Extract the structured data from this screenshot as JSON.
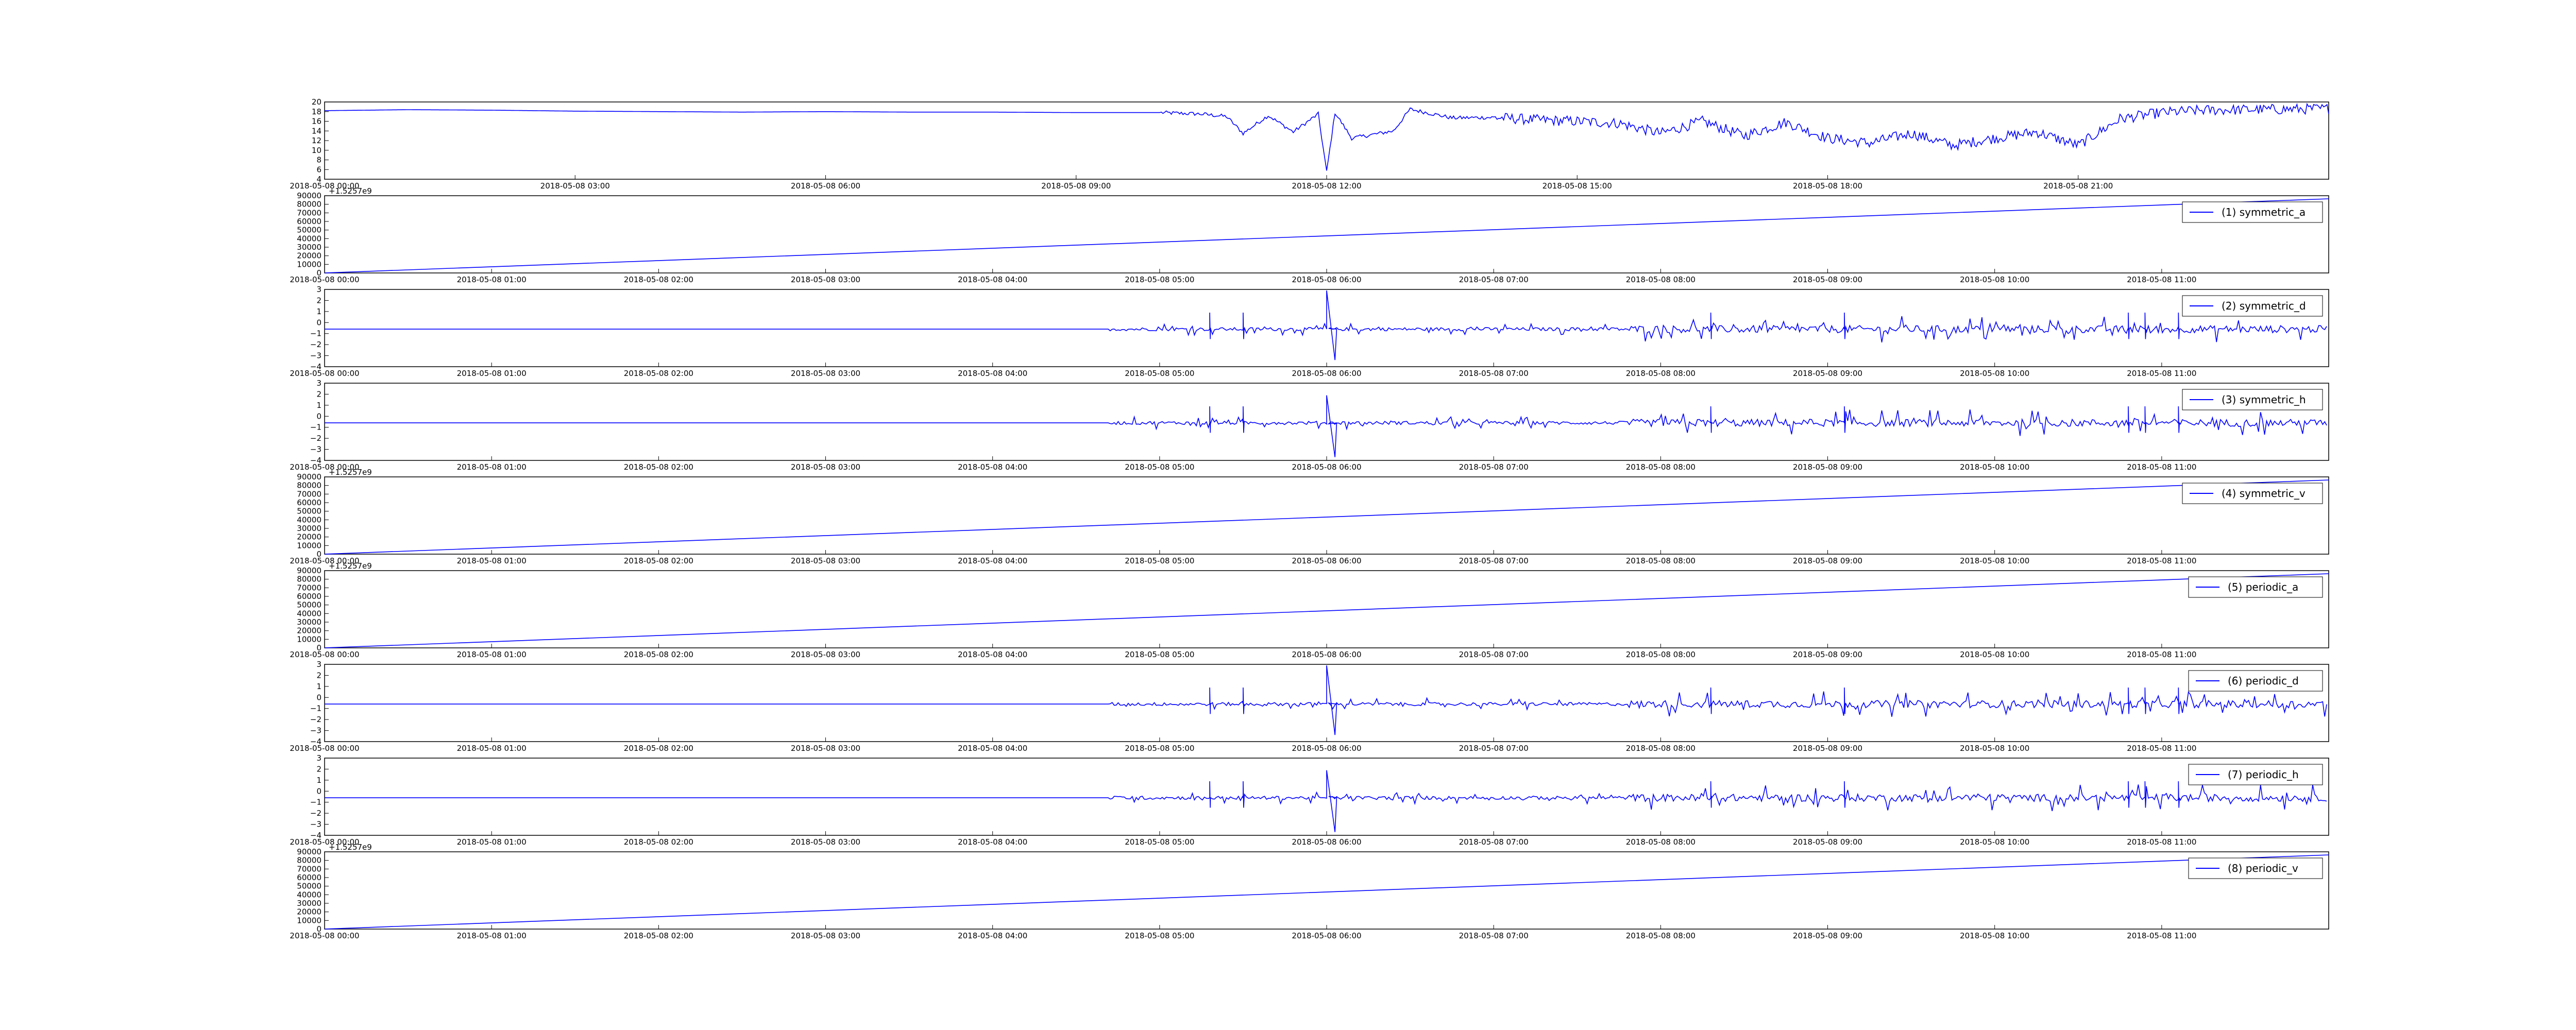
{
  "colors": {
    "series": "#0000ff",
    "axes": "#000000",
    "background": "#ffffff"
  },
  "chart_data": [
    {
      "type": "line",
      "title": "",
      "xlabel": "",
      "ylabel": "",
      "x_ticks": [
        "2018-05-08 00:00",
        "2018-05-08 03:00",
        "2018-05-08 06:00",
        "2018-05-08 09:00",
        "2018-05-08 12:00",
        "2018-05-08 15:00",
        "2018-05-08 18:00",
        "2018-05-08 21:00"
      ],
      "x_range_hours": [
        0,
        24
      ],
      "ylim": [
        4,
        20
      ],
      "y_ticks": [
        "4",
        "6",
        "8",
        "10",
        "12",
        "14",
        "16",
        "18",
        "20"
      ],
      "offset_text": "",
      "legend": "",
      "series": [
        {
          "values_hours": [
            0,
            1,
            2,
            3,
            4,
            5,
            6,
            7,
            8,
            9,
            10,
            10.5,
            10.8,
            11,
            11.3,
            11.6,
            11.9,
            12,
            12.1,
            12.3,
            12.8,
            13,
            13.5,
            14,
            14.5,
            15,
            15.5,
            16,
            16.5,
            17,
            17.5,
            18,
            18.5,
            19,
            19.5,
            20,
            20.5,
            21,
            21.5,
            22,
            22.5,
            23,
            24
          ],
          "values": [
            18.2,
            18.4,
            18.3,
            18.1,
            18.0,
            17.9,
            18.0,
            17.9,
            17.9,
            17.8,
            17.8,
            17.5,
            17.0,
            13.5,
            17.2,
            13.8,
            17.5,
            5.5,
            17.8,
            12.5,
            14.0,
            18.5,
            16.7,
            16.8,
            16.3,
            16.0,
            15.6,
            13.5,
            16.0,
            13.0,
            15.8,
            12.5,
            11.5,
            13.5,
            11.0,
            12.5,
            13.8,
            11.0,
            16.5,
            17.8,
            18.3,
            18.4,
            18.6
          ]
        }
      ]
    },
    {
      "type": "line",
      "title": "",
      "xlabel": "",
      "ylabel": "",
      "x_ticks": [
        "2018-05-08 00:00",
        "2018-05-08 01:00",
        "2018-05-08 02:00",
        "2018-05-08 03:00",
        "2018-05-08 04:00",
        "2018-05-08 05:00",
        "2018-05-08 06:00",
        "2018-05-08 07:00",
        "2018-05-08 08:00",
        "2018-05-08 09:00",
        "2018-05-08 10:00",
        "2018-05-08 11:00"
      ],
      "x_range_hours": [
        0,
        12
      ],
      "ylim": [
        0,
        90000
      ],
      "y_ticks": [
        "0",
        "10000",
        "20000",
        "30000",
        "40000",
        "50000",
        "60000",
        "70000",
        "80000",
        "90000"
      ],
      "offset_text": "+1.5257e9",
      "legend": "right",
      "series": [
        {
          "name": "(1) symmetric_a",
          "x": [
            0,
            12
          ],
          "values": [
            0,
            86400
          ]
        }
      ]
    },
    {
      "type": "line",
      "title": "",
      "xlabel": "",
      "ylabel": "",
      "x_ticks": [
        "2018-05-08 00:00",
        "2018-05-08 01:00",
        "2018-05-08 02:00",
        "2018-05-08 03:00",
        "2018-05-08 04:00",
        "2018-05-08 05:00",
        "2018-05-08 06:00",
        "2018-05-08 07:00",
        "2018-05-08 08:00",
        "2018-05-08 09:00",
        "2018-05-08 10:00",
        "2018-05-08 11:00"
      ],
      "x_range_hours": [
        0,
        12
      ],
      "ylim": [
        -4,
        3
      ],
      "y_ticks": [
        "−4",
        "−3",
        "−2",
        "−1",
        "0",
        "1",
        "2",
        "3"
      ],
      "offset_text": "",
      "legend": "right",
      "series": [
        {
          "name": "(2) symmetric_d",
          "baseline": -0.6,
          "noise_start_hours": 4.7,
          "spike": {
            "x": 6.0,
            "up": 2.9,
            "down": -3.4
          }
        }
      ]
    },
    {
      "type": "line",
      "title": "",
      "xlabel": "",
      "ylabel": "",
      "x_ticks": [
        "2018-05-08 00:00",
        "2018-05-08 01:00",
        "2018-05-08 02:00",
        "2018-05-08 03:00",
        "2018-05-08 04:00",
        "2018-05-08 05:00",
        "2018-05-08 06:00",
        "2018-05-08 07:00",
        "2018-05-08 08:00",
        "2018-05-08 09:00",
        "2018-05-08 10:00",
        "2018-05-08 11:00"
      ],
      "x_range_hours": [
        0,
        12
      ],
      "ylim": [
        -4,
        3
      ],
      "y_ticks": [
        "−4",
        "−3",
        "−2",
        "−1",
        "0",
        "1",
        "2",
        "3"
      ],
      "offset_text": "",
      "legend": "right",
      "series": [
        {
          "name": "(3) symmetric_h",
          "baseline": -0.6,
          "noise_start_hours": 4.7,
          "spike": {
            "x": 6.0,
            "up": 1.9,
            "down": -3.7
          }
        }
      ]
    },
    {
      "type": "line",
      "title": "",
      "xlabel": "",
      "ylabel": "",
      "x_ticks": [
        "2018-05-08 00:00",
        "2018-05-08 01:00",
        "2018-05-08 02:00",
        "2018-05-08 03:00",
        "2018-05-08 04:00",
        "2018-05-08 05:00",
        "2018-05-08 06:00",
        "2018-05-08 07:00",
        "2018-05-08 08:00",
        "2018-05-08 09:00",
        "2018-05-08 10:00",
        "2018-05-08 11:00"
      ],
      "x_range_hours": [
        0,
        12
      ],
      "ylim": [
        0,
        90000
      ],
      "y_ticks": [
        "0",
        "10000",
        "20000",
        "30000",
        "40000",
        "50000",
        "60000",
        "70000",
        "80000",
        "90000"
      ],
      "offset_text": "+1.5257e9",
      "legend": "right",
      "series": [
        {
          "name": "(4) symmetric_v",
          "x": [
            0,
            12
          ],
          "values": [
            0,
            86400
          ]
        }
      ]
    },
    {
      "type": "line",
      "title": "",
      "xlabel": "",
      "ylabel": "",
      "x_ticks": [
        "2018-05-08 00:00",
        "2018-05-08 01:00",
        "2018-05-08 02:00",
        "2018-05-08 03:00",
        "2018-05-08 04:00",
        "2018-05-08 05:00",
        "2018-05-08 06:00",
        "2018-05-08 07:00",
        "2018-05-08 08:00",
        "2018-05-08 09:00",
        "2018-05-08 10:00",
        "2018-05-08 11:00"
      ],
      "x_range_hours": [
        0,
        12
      ],
      "ylim": [
        0,
        90000
      ],
      "y_ticks": [
        "0",
        "10000",
        "20000",
        "30000",
        "40000",
        "50000",
        "60000",
        "70000",
        "80000",
        "90000"
      ],
      "offset_text": "+1.5257e9",
      "legend": "right",
      "series": [
        {
          "name": "(5) periodic_a",
          "x": [
            0,
            12
          ],
          "values": [
            0,
            86400
          ]
        }
      ]
    },
    {
      "type": "line",
      "title": "",
      "xlabel": "",
      "ylabel": "",
      "x_ticks": [
        "2018-05-08 00:00",
        "2018-05-08 01:00",
        "2018-05-08 02:00",
        "2018-05-08 03:00",
        "2018-05-08 04:00",
        "2018-05-08 05:00",
        "2018-05-08 06:00",
        "2018-05-08 07:00",
        "2018-05-08 08:00",
        "2018-05-08 09:00",
        "2018-05-08 10:00",
        "2018-05-08 11:00"
      ],
      "x_range_hours": [
        0,
        12
      ],
      "ylim": [
        -4,
        3
      ],
      "y_ticks": [
        "−4",
        "−3",
        "−2",
        "−1",
        "0",
        "1",
        "2",
        "3"
      ],
      "offset_text": "",
      "legend": "right",
      "series": [
        {
          "name": "(6) periodic_d",
          "baseline": -0.6,
          "noise_start_hours": 4.7,
          "spike": {
            "x": 6.0,
            "up": 2.9,
            "down": -3.4
          }
        }
      ]
    },
    {
      "type": "line",
      "title": "",
      "xlabel": "",
      "ylabel": "",
      "x_ticks": [
        "2018-05-08 00:00",
        "2018-05-08 01:00",
        "2018-05-08 02:00",
        "2018-05-08 03:00",
        "2018-05-08 04:00",
        "2018-05-08 05:00",
        "2018-05-08 06:00",
        "2018-05-08 07:00",
        "2018-05-08 08:00",
        "2018-05-08 09:00",
        "2018-05-08 10:00",
        "2018-05-08 11:00"
      ],
      "x_range_hours": [
        0,
        12
      ],
      "ylim": [
        -4,
        3
      ],
      "y_ticks": [
        "−4",
        "−3",
        "−2",
        "−1",
        "0",
        "1",
        "2",
        "3"
      ],
      "offset_text": "",
      "legend": "right",
      "series": [
        {
          "name": "(7) periodic_h",
          "baseline": -0.6,
          "noise_start_hours": 4.7,
          "spike": {
            "x": 6.0,
            "up": 1.9,
            "down": -3.7
          }
        }
      ]
    },
    {
      "type": "line",
      "title": "",
      "xlabel": "",
      "ylabel": "",
      "x_ticks": [
        "2018-05-08 00:00",
        "2018-05-08 01:00",
        "2018-05-08 02:00",
        "2018-05-08 03:00",
        "2018-05-08 04:00",
        "2018-05-08 05:00",
        "2018-05-08 06:00",
        "2018-05-08 07:00",
        "2018-05-08 08:00",
        "2018-05-08 09:00",
        "2018-05-08 10:00",
        "2018-05-08 11:00"
      ],
      "x_range_hours": [
        0,
        12
      ],
      "ylim": [
        0,
        90000
      ],
      "y_ticks": [
        "0",
        "10000",
        "20000",
        "30000",
        "40000",
        "50000",
        "60000",
        "70000",
        "80000",
        "90000"
      ],
      "offset_text": "+1.5257e9",
      "legend": "right",
      "series": [
        {
          "name": "(8) periodic_v",
          "x": [
            0,
            12
          ],
          "values": [
            0,
            86400
          ]
        }
      ]
    }
  ]
}
